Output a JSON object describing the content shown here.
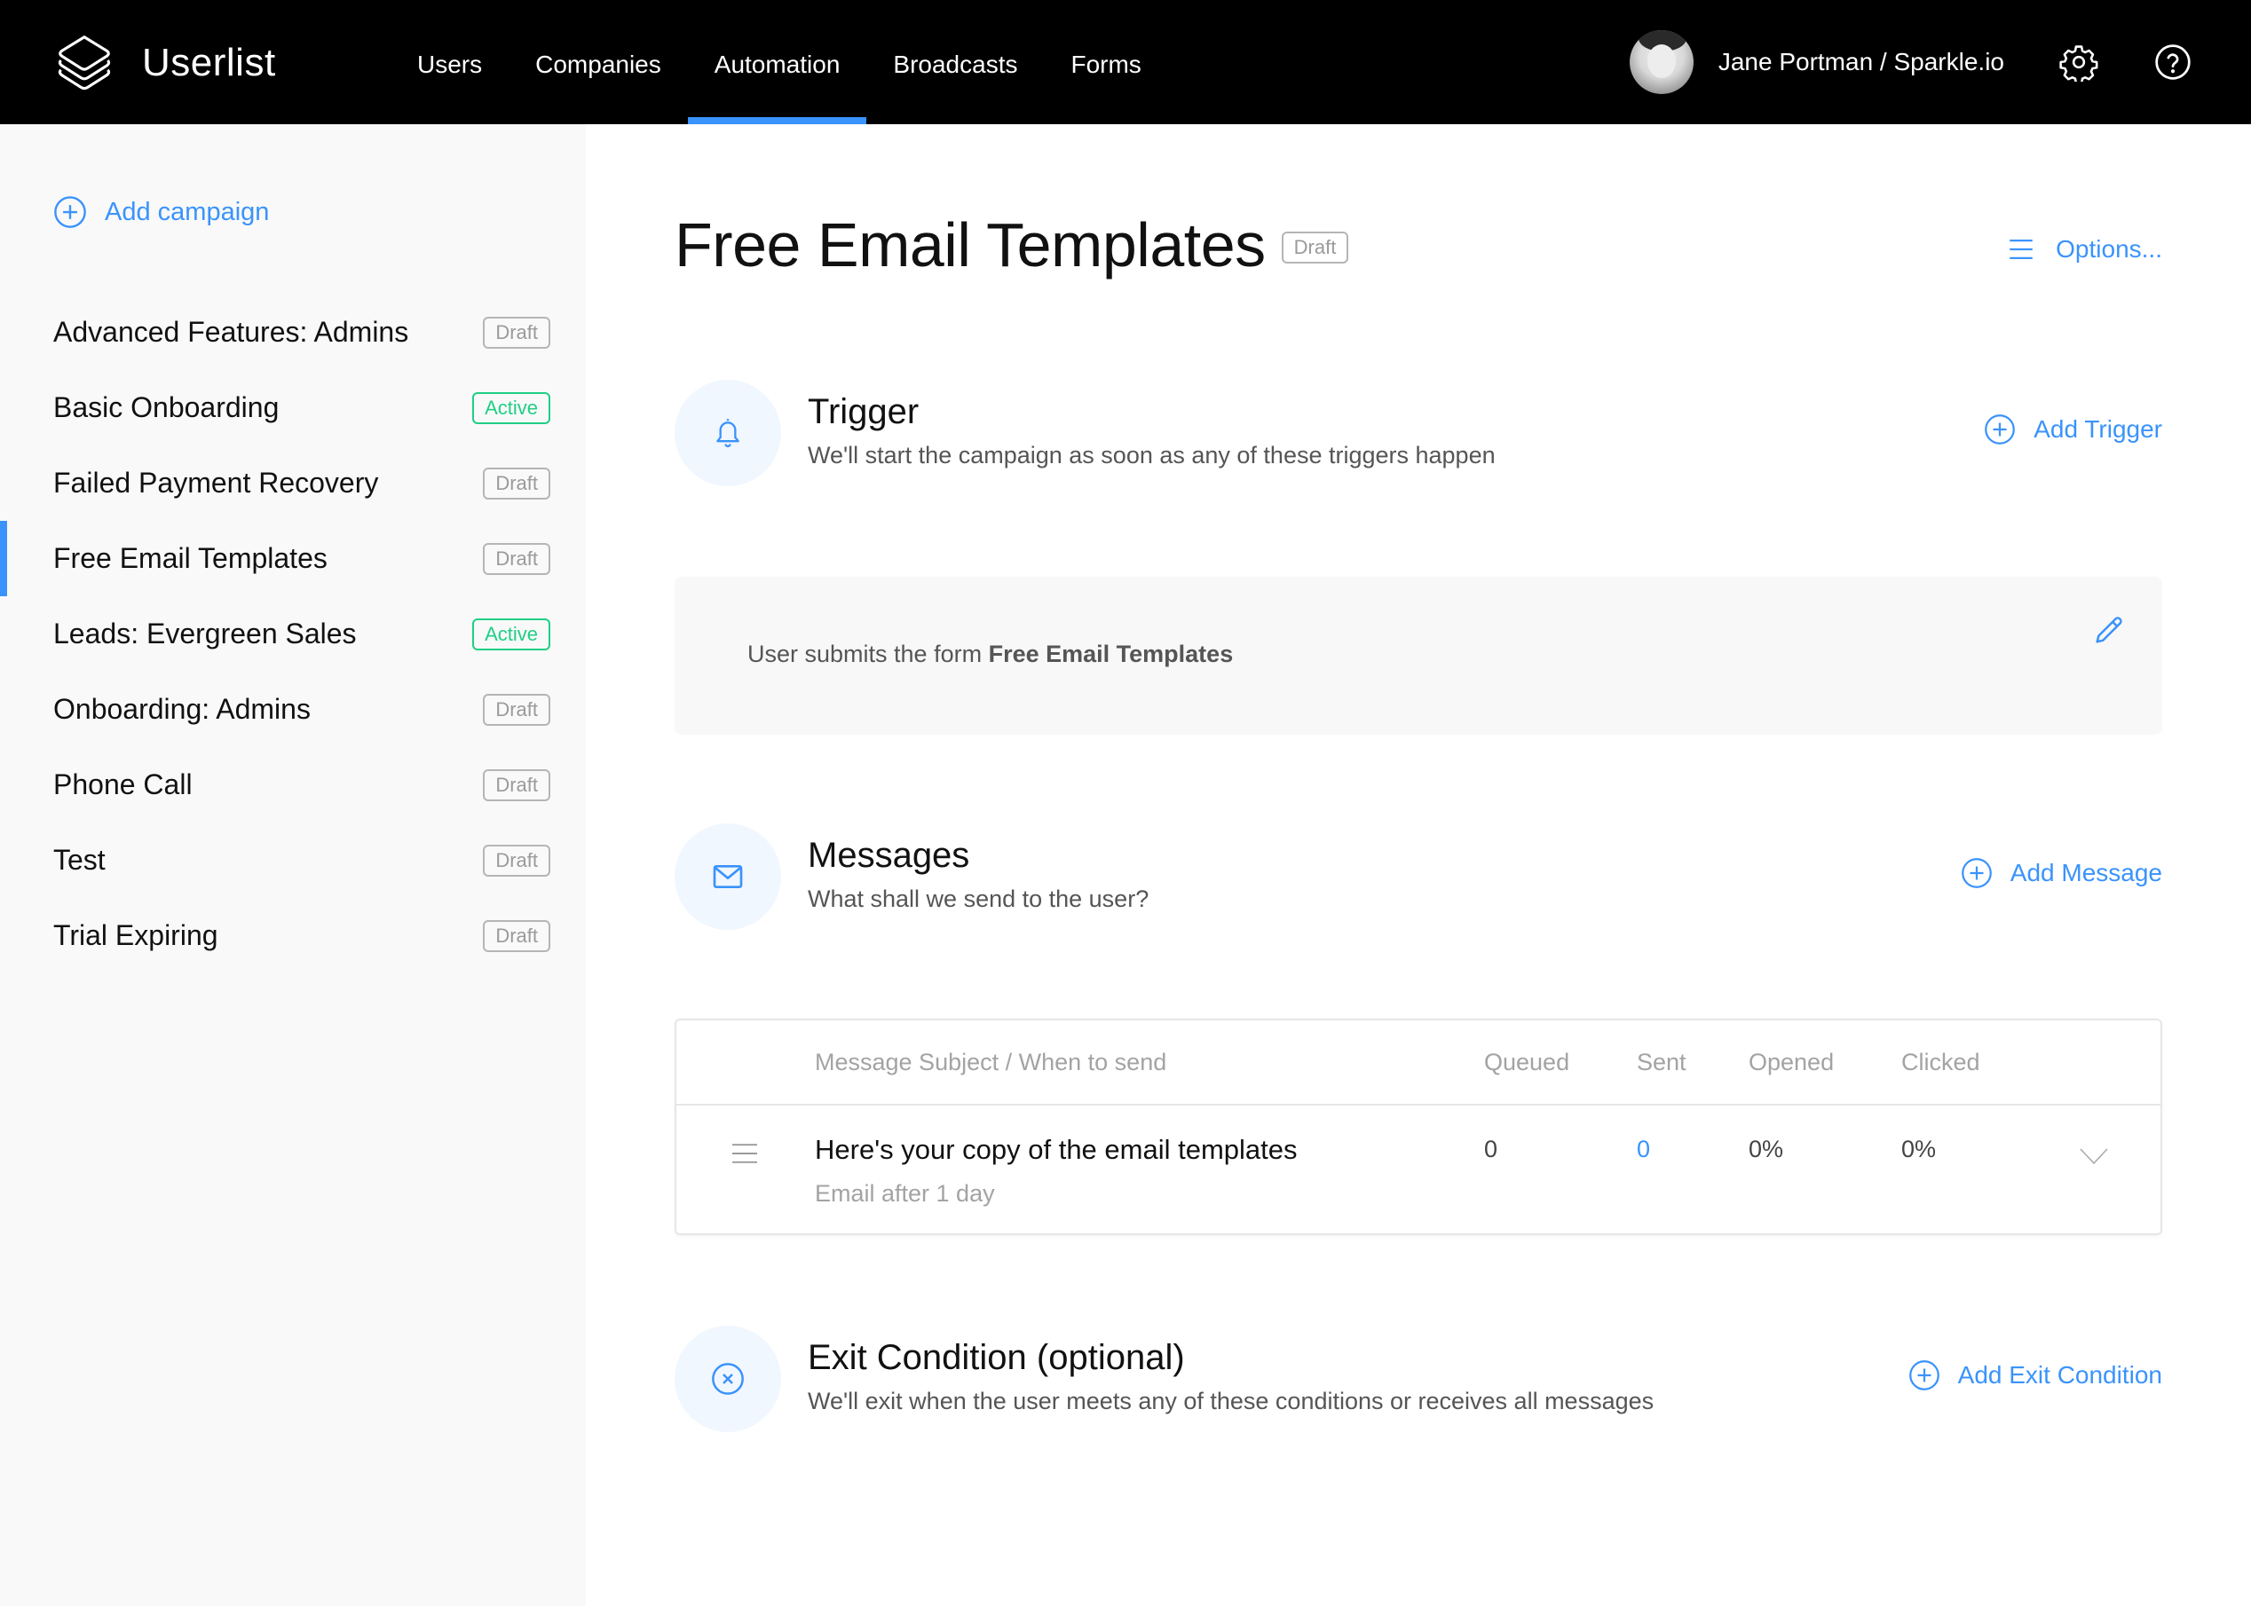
{
  "app": {
    "name": "Userlist",
    "logo_icon": "layers-stack-icon"
  },
  "nav": {
    "items": [
      {
        "label": "Users",
        "active": false
      },
      {
        "label": "Companies",
        "active": false
      },
      {
        "label": "Automation",
        "active": true
      },
      {
        "label": "Broadcasts",
        "active": false
      },
      {
        "label": "Forms",
        "active": false
      }
    ]
  },
  "user": {
    "name": "Jane Portman / Sparkle.io",
    "settings_icon": "gear-icon",
    "help_icon": "question-circle-icon"
  },
  "sidebar": {
    "add_campaign_label": "Add campaign",
    "campaigns": [
      {
        "name": "Advanced Features: Admins",
        "status": "Draft",
        "active": false
      },
      {
        "name": "Basic Onboarding",
        "status": "Active",
        "active": false
      },
      {
        "name": "Failed Payment Recovery",
        "status": "Draft",
        "active": false
      },
      {
        "name": "Free Email Templates",
        "status": "Draft",
        "active": true
      },
      {
        "name": "Leads: Evergreen Sales",
        "status": "Active",
        "active": false
      },
      {
        "name": "Onboarding: Admins",
        "status": "Draft",
        "active": false
      },
      {
        "name": "Phone Call",
        "status": "Draft",
        "active": false
      },
      {
        "name": "Test",
        "status": "Draft",
        "active": false
      },
      {
        "name": "Trial Expiring",
        "status": "Draft",
        "active": false
      }
    ]
  },
  "main": {
    "title": "Free Email Templates",
    "status": "Draft",
    "options_label": "Options...",
    "trigger": {
      "title": "Trigger",
      "description": "We'll start the campaign as soon as any of these triggers happen",
      "action_label": "Add Trigger",
      "rule_prefix": "User submits the form",
      "rule_target": "Free Email Templates"
    },
    "messages": {
      "title": "Messages",
      "description": "What shall we send to the user?",
      "action_label": "Add Message",
      "columns": {
        "subject": "Message Subject / When to send",
        "queued": "Queued",
        "sent": "Sent",
        "opened": "Opened",
        "clicked": "Clicked"
      },
      "rows": [
        {
          "subject": "Here's your copy of the email templates",
          "when": "Email after 1 day",
          "queued": "0",
          "sent": "0",
          "opened": "0%",
          "clicked": "0%"
        }
      ]
    },
    "exit": {
      "title": "Exit Condition (optional)",
      "description": "We'll exit when the user meets any of these conditions or receives all messages",
      "action_label": "Add Exit Condition"
    }
  },
  "colors": {
    "accent": "#3a93fb",
    "active_badge": "#1fcf85",
    "draft_badge": "#9a9a9a",
    "header_bg": "#000000",
    "sidebar_bg": "#f9f9f9"
  }
}
